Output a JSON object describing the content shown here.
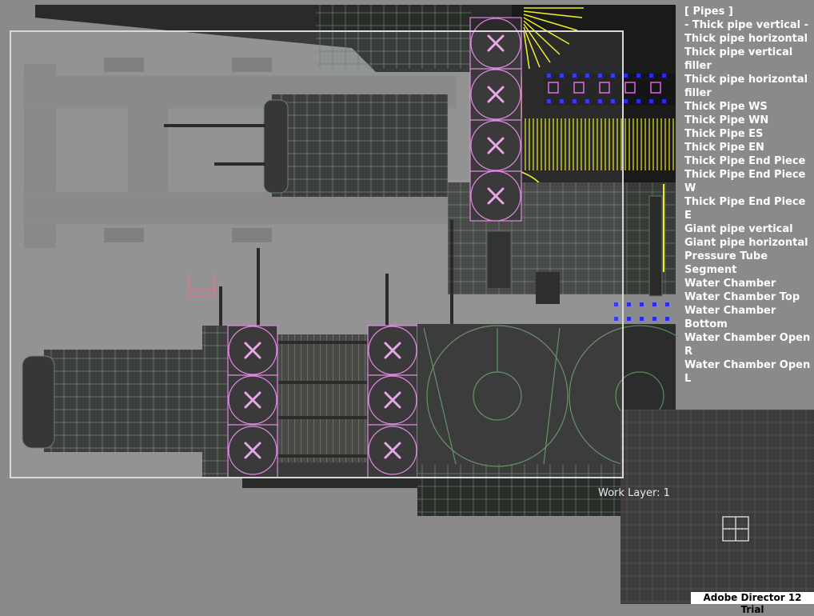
{
  "palette": {
    "category": "[ Pipes ]",
    "items": [
      "- Thick pipe vertical -",
      "Thick pipe horizontal",
      "Thick pipe vertical filler",
      "Thick pipe horizontal filler",
      "Thick Pipe WS",
      "Thick Pipe WN",
      "Thick Pipe ES",
      "Thick Pipe EN",
      "Thick Pipe End Piece",
      "Thick Pipe End Piece W",
      "Thick Pipe End Piece E",
      "Giant pipe vertical",
      "Giant pipe horizontal",
      "Pressure Tube Segment",
      "Water Chamber",
      "Water Chamber Top",
      "Water Chamber Bottom",
      "Water Chamber Open R",
      "Water Chamber Open L"
    ]
  },
  "status": {
    "work_layer": "Work Layer: 1"
  },
  "watermark": "Adobe Director 12 Trial",
  "colors": {
    "background": "#8a8a8a",
    "tile_dark": "#2a2a2a",
    "grid_line": "#5f8a5f",
    "highlight_pink": "#e080e0",
    "accent_yellow": "#f0f020",
    "accent_blue": "#2020e0"
  }
}
